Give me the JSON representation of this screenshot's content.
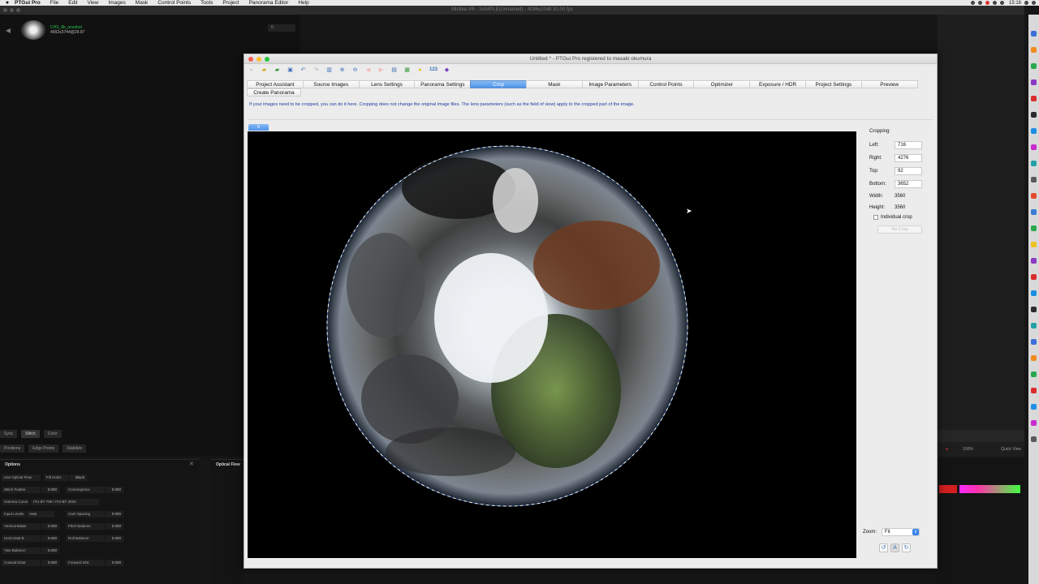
{
  "menubar": {
    "app": "PTGui Pro",
    "items": [
      "File",
      "Edit",
      "View",
      "Images",
      "Mask",
      "Control Points",
      "Tools",
      "Project",
      "Panorama Editor",
      "Help"
    ],
    "clock": "15:18"
  },
  "host": {
    "title": "Mistika VR - SAMPLE(Unnamed) - 4096x2048 30.00 fps",
    "clip_name": "CHS_8k_onsshot",
    "clip_res": "4992x3744@29.97",
    "field_value": "0",
    "tabs": [
      "Sync",
      "Stitch",
      "Color"
    ],
    "subtabs": [
      "Positions",
      "Edge Points",
      "Stabilize"
    ],
    "options_title": "Options",
    "optical_flow_title": "Optical Flow",
    "options": [
      {
        "label": "Use Optical Flow",
        "value": ""
      },
      {
        "label": "Fill Holes",
        "value": "Black"
      },
      {
        "label": "Stitch Feathe",
        "value": "0.000"
      },
      {
        "label": "Convergence",
        "value": "0.000"
      },
      {
        "label": "Gamma Curve",
        "value": "ITU-BT 709 / ITU-BT 2020"
      },
      {
        "label": "Input Levels",
        "value": "Auto"
      },
      {
        "label": "Cam Spacing",
        "value": "0.000"
      },
      {
        "label": "Vertical Balan",
        "value": "0.000"
      },
      {
        "label": "Pitch Balance",
        "value": "0.000"
      },
      {
        "label": "Horizontal B.",
        "value": "0.000"
      },
      {
        "label": "Roll Balance:",
        "value": "0.000"
      },
      {
        "label": "Yaw Balance:",
        "value": "0.000"
      },
      {
        "label": "Coaxial Dista",
        "value": "0.000"
      },
      {
        "label": "Forward Dist.",
        "value": "0.000"
      }
    ],
    "zoom_value": "100%",
    "quick_view": "Quick View"
  },
  "ptgui": {
    "title": "Untitled * - PTGui Pro registered to masaki okumura",
    "toolbar_num": "123",
    "tabs": [
      {
        "label": "Project Assistant",
        "active": false
      },
      {
        "label": "Source Images",
        "active": false
      },
      {
        "label": "Lens Settings",
        "active": false
      },
      {
        "label": "Panorama Settings",
        "active": false
      },
      {
        "label": "Crop",
        "active": true
      },
      {
        "label": "Mask",
        "active": false
      },
      {
        "label": "Image Parameters",
        "active": false
      },
      {
        "label": "Control Points",
        "active": false
      },
      {
        "label": "Optimizer",
        "active": false
      },
      {
        "label": "Exposure / HDR",
        "active": false
      },
      {
        "label": "Project Settings",
        "active": false
      },
      {
        "label": "Preview",
        "active": false
      },
      {
        "label": "Create Panorama",
        "active": false
      }
    ],
    "info": "If your images need to be cropped, you can do it here. Cropping does not change the original image files. The lens parameters (such as the field of view) apply to the cropped part of the image.",
    "image_tab": "0",
    "cropping": {
      "title": "Cropping:",
      "left_label": "Left:",
      "left": "716",
      "right_label": "Right:",
      "right": "4276",
      "top_label": "Top:",
      "top": "92",
      "bottom_label": "Bottom:",
      "bottom": "3652",
      "width_label": "Width:",
      "width": "3560",
      "height_label": "Height:",
      "height": "3560",
      "individual_crop": "Individual crop",
      "no_crop": "No Crop"
    },
    "zoom_label": "Zoom:",
    "zoom_value": "Fit"
  }
}
